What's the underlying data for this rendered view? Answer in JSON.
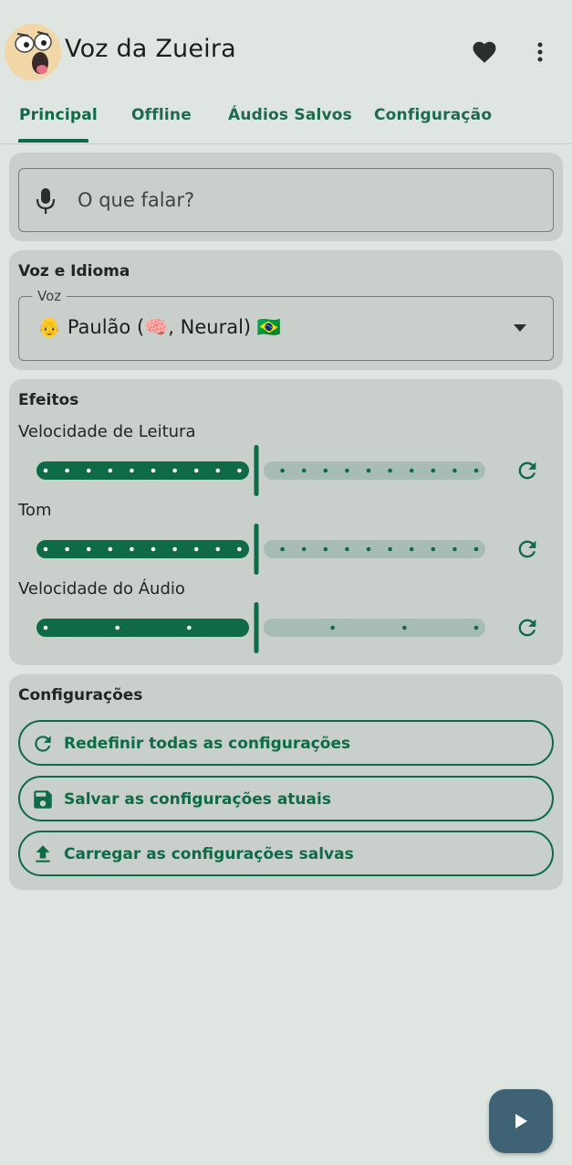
{
  "app": {
    "title": "Voz da Zueira"
  },
  "tabs": [
    {
      "label": "Principal",
      "active": true
    },
    {
      "label": "Offline",
      "active": false
    },
    {
      "label": "Áudios Salvos",
      "active": false
    },
    {
      "label": "Configuração",
      "active": false
    }
  ],
  "speak": {
    "placeholder": "O que falar?"
  },
  "voice_card": {
    "title": "Voz e Idioma",
    "voice_label": "Voz",
    "voice_value": "👴 Paulão (🧠, Neural) 🇧🇷"
  },
  "effects": {
    "title": "Efeitos",
    "sliders": [
      {
        "label": "Velocidade de Leitura",
        "value_fraction": 0.5,
        "ticks": 21
      },
      {
        "label": "Tom",
        "value_fraction": 0.5,
        "ticks": 21
      },
      {
        "label": "Velocidade do Áudio",
        "value_fraction": 0.5,
        "ticks": 7
      }
    ]
  },
  "config_card": {
    "title": "Configurações",
    "buttons": [
      {
        "label": "Redefinir todas as configurações",
        "icon": "refresh-icon"
      },
      {
        "label": "Salvar as configurações atuais",
        "icon": "save-icon"
      },
      {
        "label": "Carregar as configurações salvas",
        "icon": "upload-icon"
      }
    ]
  },
  "colors": {
    "primary": "#0f6a46",
    "track_inactive": "#a7bcb2",
    "card": "#c9cfca",
    "background": "#dfe5e0",
    "fab": "#3f6275"
  }
}
